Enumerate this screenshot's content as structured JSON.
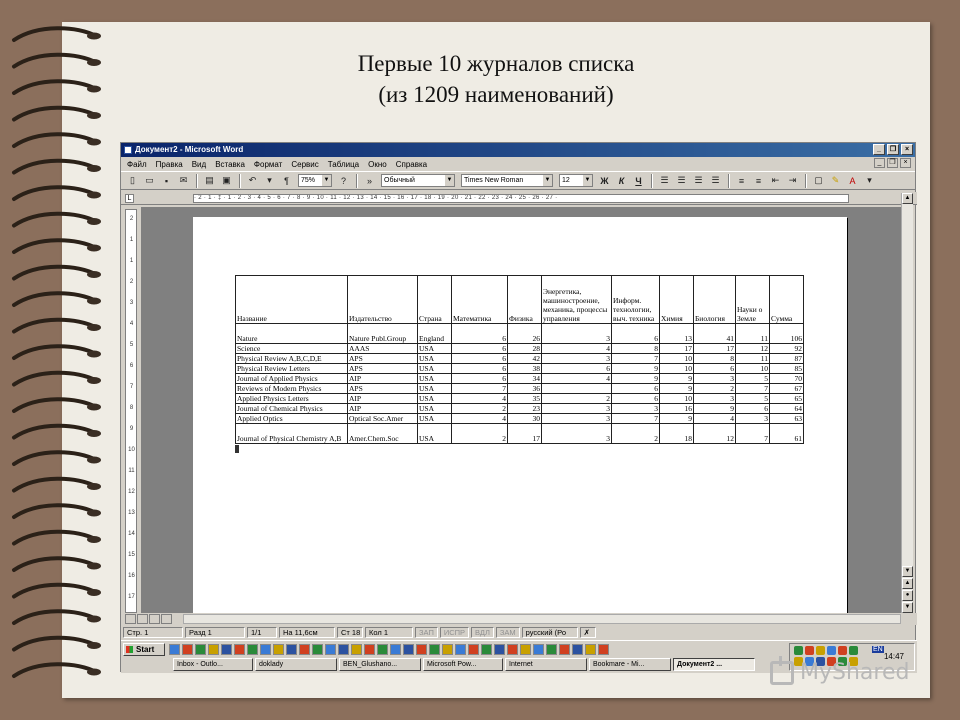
{
  "slide": {
    "title_line1": "Первые 10 журналов списка",
    "title_line2": "(из 1209 наименований)"
  },
  "window": {
    "title": "Документ2 - Microsoft Word",
    "min": "_",
    "restore": "❐",
    "close": "×"
  },
  "menu": [
    "Файл",
    "Правка",
    "Вид",
    "Вставка",
    "Формат",
    "Сервис",
    "Таблица",
    "Окно",
    "Справка"
  ],
  "toolbar": {
    "zoom": "75%",
    "style": "Обычный",
    "font": "Times New Roman",
    "size": "12",
    "bold": "Ж",
    "italic": "К",
    "underline": "Ч",
    "pilcrow": "¶"
  },
  "ruler": {
    "text": "· 2 · 1 · ‡ · 1 · 2 · 3 · 4 · 5 · 6 · 7 · 8 · 9 · 10 · 11 · 12 · 13 · 14 · 15 · 16 · 17 · 18 · 19 · 20 · 21 · 22 · 23 · 24 · 25 · 26 · 27 ·",
    "tab_selector": "L",
    "vertical_ticks": [
      "2",
      "1",
      "1",
      "2",
      "3",
      "4",
      "5",
      "6",
      "7",
      "8",
      "9",
      "10",
      "11",
      "12",
      "13",
      "14",
      "15",
      "16",
      "17"
    ]
  },
  "table": {
    "headers": [
      "Название",
      "Издательство",
      "Страна",
      "Математика",
      "Физика",
      "Энергетика, машиностроение, механика, процессы управления",
      "Информ. технологии, выч. техника",
      "Химия",
      "Биология",
      "Науки о Земле",
      "Сумма"
    ],
    "rows": [
      {
        "name": "Nature",
        "publisher": "Nature Publ.Group",
        "country": "England",
        "v": [
          "6",
          "26",
          "3",
          "6",
          "13",
          "41",
          "11",
          "106"
        ]
      },
      {
        "name": "Science",
        "publisher": "AAAS",
        "country": "USA",
        "v": [
          "6",
          "28",
          "4",
          "8",
          "17",
          "17",
          "12",
          "92"
        ]
      },
      {
        "name": "Physical Review A,B,C,D,E",
        "publisher": "APS",
        "country": "USA",
        "v": [
          "6",
          "42",
          "3",
          "7",
          "10",
          "8",
          "11",
          "87"
        ]
      },
      {
        "name": "Physical Review Letters",
        "publisher": "APS",
        "country": "USA",
        "v": [
          "6",
          "38",
          "6",
          "9",
          "10",
          "6",
          "10",
          "85"
        ]
      },
      {
        "name": "Journal of Applied Physics",
        "publisher": "AIP",
        "country": "USA",
        "v": [
          "6",
          "34",
          "4",
          "9",
          "9",
          "3",
          "5",
          "70"
        ]
      },
      {
        "name": "Reviews of Modern Physics",
        "publisher": "APS",
        "country": "USA",
        "v": [
          "7",
          "36",
          "",
          "6",
          "9",
          "2",
          "7",
          "67"
        ]
      },
      {
        "name": "Applied Physics Letters",
        "publisher": "AIP",
        "country": "USA",
        "v": [
          "4",
          "35",
          "2",
          "6",
          "10",
          "3",
          "5",
          "65"
        ]
      },
      {
        "name": "Journal of Chemical Physics",
        "publisher": "AIP",
        "country": "USA",
        "v": [
          "2",
          "23",
          "3",
          "3",
          "16",
          "9",
          "6",
          "64"
        ]
      },
      {
        "name": "Applied Optics",
        "publisher": "Optical Soc.Amer",
        "country": "USA",
        "v": [
          "4",
          "30",
          "3",
          "7",
          "9",
          "4",
          "3",
          "63"
        ]
      },
      {
        "name": "Journal of Physical Chemistry A,B",
        "publisher": "Amer.Chem.Soc",
        "country": "USA",
        "v": [
          "2",
          "17",
          "3",
          "2",
          "18",
          "12",
          "7",
          "61"
        ]
      }
    ]
  },
  "status": {
    "page": "Стр. 1",
    "section": "Разд 1",
    "pages": "1/1",
    "at": "На 11,6см",
    "line": "Ст 18",
    "col": "Кол 1",
    "rec": "ЗАП",
    "trk": "ИСПР",
    "ext": "ВДЛ",
    "ovr": "ЗАМ",
    "lang": "русский (Ро"
  },
  "taskbar": {
    "start": "Start",
    "tasks": [
      "Inbox - Outlo...",
      "doklady",
      "BEN_Glushano...",
      "Microsoft Pow...",
      "Internet",
      "Bookmare - Mi...",
      "Документ2 ..."
    ],
    "lang": "EN",
    "clock": "14:47"
  },
  "watermark": "MyShared"
}
